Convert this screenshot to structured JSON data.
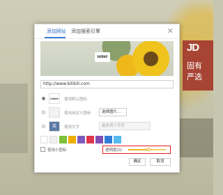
{
  "background": {
    "brand_block": {
      "logo_text": "JD",
      "line1": "固有",
      "line2": "严选"
    }
  },
  "dialog": {
    "tabs": [
      {
        "label": "添加网址",
        "active": true
      },
      {
        "label": "添加搜索引擎",
        "active": false
      }
    ],
    "close_icon": "close-icon",
    "banner": {
      "logo_text": "bilibili"
    },
    "url_value": "http://www.bilibili.com",
    "options": [
      {
        "thumb": "bilibili",
        "label": "使用默认图标",
        "selected": true
      },
      {
        "thumb": "",
        "label": "使用自定义图标",
        "button": "选择图片...",
        "selected": false
      },
      {
        "thumb": "英",
        "label": "使用文字",
        "placeholder": "最多两个字符",
        "selected": false
      }
    ],
    "swatch_colors": [
      "#7ec03a",
      "#f0ad00",
      "#7d5cbf",
      "#e0344d",
      "#7f4fb3",
      "#2f7dd6",
      "#56b9f0"
    ],
    "checkbox_label": "使用小图标",
    "opacity": {
      "label": "透明度(0)",
      "value": 0.55
    },
    "buttons": {
      "ok": "确定",
      "cancel": "取消"
    }
  }
}
